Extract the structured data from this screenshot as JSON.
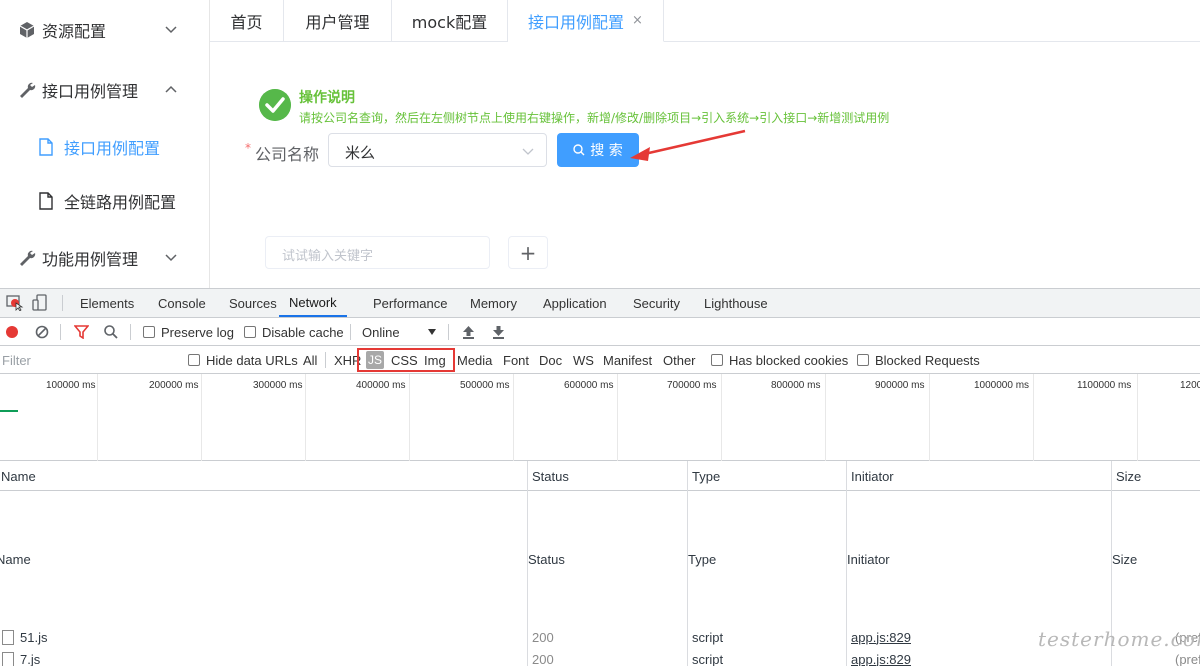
{
  "sidebar": {
    "items": [
      {
        "label": "资源配置",
        "icon": "cube-icon",
        "chevron": "down"
      },
      {
        "label": "接口用例管理",
        "icon": "wrench-icon",
        "chevron": "up"
      },
      {
        "label": "功能用例管理",
        "icon": "wrench-icon",
        "chevron": "down"
      }
    ],
    "sub_items": [
      {
        "label": "接口用例配置",
        "icon": "file-icon",
        "active": true
      },
      {
        "label": "全链路用例配置",
        "icon": "file-icon",
        "active": false
      }
    ]
  },
  "tabs": [
    {
      "label": "首页"
    },
    {
      "label": "用户管理"
    },
    {
      "label": "mock配置"
    },
    {
      "label": "接口用例配置",
      "active": true,
      "close": "×"
    }
  ],
  "instructions": {
    "title": "操作说明",
    "description": "请按公司名查询，然后在左侧树节点上使用右键操作，新增/修改/删除项目→引入系统→引入接口→新增测试用例"
  },
  "form": {
    "required_mark": "*",
    "company_label": "公司名称",
    "company_value": "米么",
    "search_label": "搜 索"
  },
  "tree": {
    "keyword_placeholder": "试试输入关键字",
    "add_label": "+"
  },
  "devtools": {
    "tabs": [
      "Elements",
      "Console",
      "Sources",
      "Network",
      "Performance",
      "Memory",
      "Application",
      "Security",
      "Lighthouse"
    ],
    "active_tab": "Network",
    "toolbar": {
      "preserve_log": "Preserve log",
      "disable_cache": "Disable cache",
      "throttle": "Online"
    },
    "filter": {
      "placeholder": "Filter",
      "hide_data_urls": "Hide data URLs",
      "types": [
        "All",
        "XHR",
        "JS",
        "CSS",
        "Img",
        "Media",
        "Font",
        "Doc",
        "WS",
        "Manifest",
        "Other"
      ],
      "active_type": "JS",
      "has_blocked_cookies": "Has blocked cookies",
      "blocked_requests": "Blocked Requests"
    },
    "timeline_ticks": [
      "100000 ms",
      "200000 ms",
      "300000 ms",
      "400000 ms",
      "500000 ms",
      "600000 ms",
      "700000 ms",
      "800000 ms",
      "900000 ms",
      "1000000 ms",
      "1100000 ms",
      "1200"
    ],
    "columns": [
      "Name",
      "Status",
      "Type",
      "Initiator",
      "Size"
    ],
    "columns_duplicate": [
      "Name",
      "Status",
      "Type",
      "Initiator",
      "Size"
    ],
    "rows": [
      {
        "name": "51.js",
        "status": "200",
        "type": "script",
        "initiator": "app.js:829",
        "size": "(pref"
      },
      {
        "name": "7.js",
        "status": "200",
        "type": "script",
        "initiator": "app.js:829",
        "size": "(pref"
      }
    ]
  },
  "watermark": "testerhome.com",
  "colors": {
    "primary": "#409eff",
    "success": "#67c23a",
    "highlight": "#e53935"
  }
}
